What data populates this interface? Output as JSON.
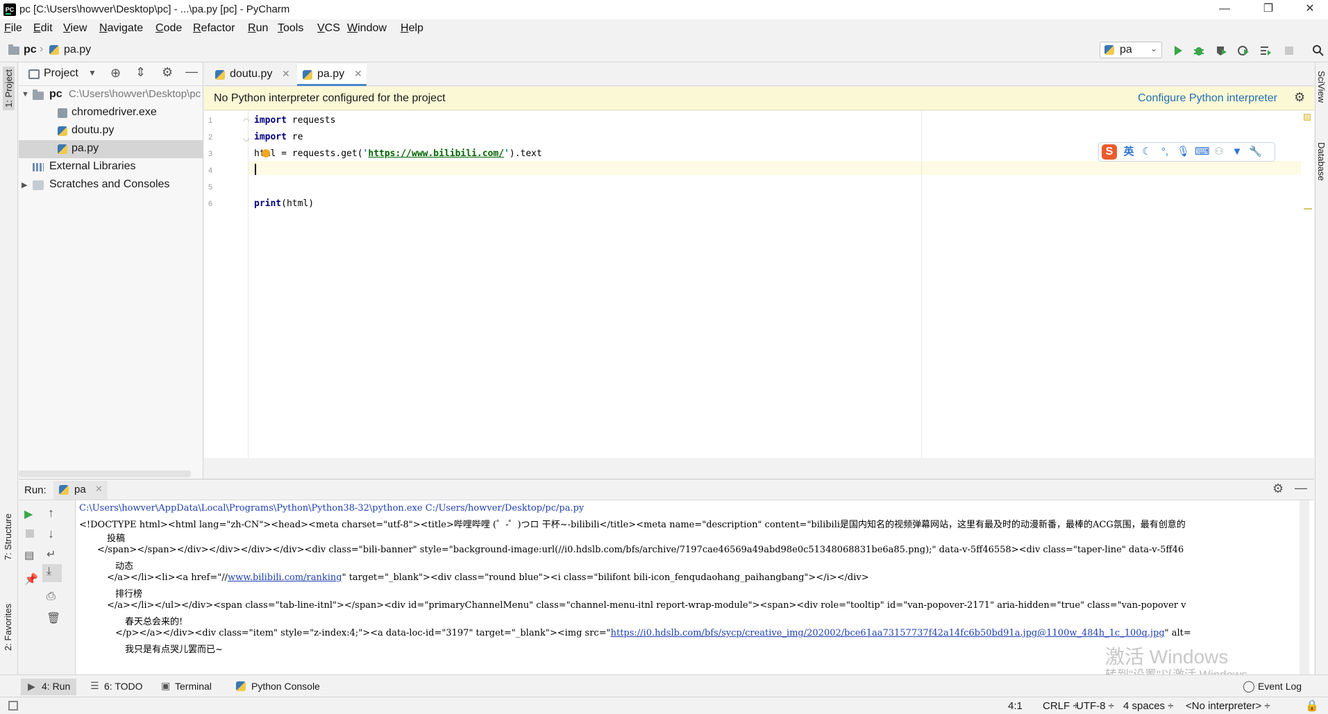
{
  "window": {
    "title": "pc [C:\\Users\\howver\\Desktop\\pc] - ...\\pa.py [pc] - PyCharm",
    "logo_text": "PC",
    "minimize": "—",
    "restore": "❐",
    "close": "✕"
  },
  "menu": [
    "File",
    "Edit",
    "View",
    "Navigate",
    "Code",
    "Refactor",
    "Run",
    "Tools",
    "VCS",
    "Window",
    "Help"
  ],
  "breadcrumb": {
    "project": "pc",
    "file": "pa.py"
  },
  "run_config": {
    "selected": "pa"
  },
  "left_stripe": {
    "project": "1: Project",
    "structure": "7: Structure",
    "favorites": "2: Favorites"
  },
  "right_stripe": {
    "sciview": "SciView",
    "database": "Database"
  },
  "project_panel": {
    "title": "Project",
    "root_label": "pc",
    "root_path": "C:\\Users\\howver\\Desktop\\pc",
    "files": [
      "chromedriver.exe",
      "doutu.py",
      "pa.py"
    ],
    "external": "External Libraries",
    "scratches": "Scratches and Consoles"
  },
  "editor": {
    "tabs": [
      {
        "label": "doutu.py",
        "active": false
      },
      {
        "label": "pa.py",
        "active": true
      }
    ],
    "notification": "No Python interpreter configured for the project",
    "notification_action": "Configure Python interpreter",
    "line_numbers": [
      "1",
      "2",
      "3",
      "4",
      "5",
      "6"
    ],
    "code": {
      "l1_kw": "import",
      "l1_rest": " requests",
      "l2_kw": "import",
      "l2_rest": " re",
      "l3_a": "html = requests.get(",
      "l3_q1": "'",
      "l3_url": "https://www.bilibili.com/",
      "l3_q2": "'",
      "l3_b": ").text",
      "l6_fn": "print",
      "l6_rest": "(html)"
    }
  },
  "ime": {
    "brand": "S",
    "mode": "英",
    "icons": [
      "moon-icon",
      "comma-icon",
      "mic-icon",
      "keyboard-icon",
      "user-icon",
      "shirt-icon",
      "wrench-icon"
    ]
  },
  "run_panel": {
    "label": "Run:",
    "tab": "pa",
    "console": {
      "l1": "C:\\Users\\howver\\AppData\\Local\\Programs\\Python\\Python38-32\\python.exe C:/Users/howver/Desktop/pc/pa.py",
      "l2": "<!DOCTYPE html><html lang=\"zh-CN\"><head><meta charset=\"utf-8\"><title>哔哩哔哩 (゜-゜)つロ 干杯~-bilibili</title><meta name=\"description\" content=\"bilibili是国内知名的视频弹幕网站，这里有最及时的动漫新番，最棒的ACG氛围，最有创意的",
      "l3": "投稿",
      "l4": "</span></span></div></div></div></div><div class=\"bili-banner\" style=\"background-image:url(//i0.hdslb.com/bfs/archive/7197cae46569a49abd98e0c51348068831be6a85.png);\" data-v-5ff46558><div class=\"taper-line\" data-v-5ff46",
      "l5": "动态",
      "l6_a": "</a></li><li><a href=\"//",
      "l6_link": "www.bilibili.com/ranking",
      "l6_b": "\" target=\"_blank\"><div class=\"round blue\"><i class=\"bilifont bili-icon_fenqudaohang_paihangbang\"></i></div>",
      "l7": "排行榜",
      "l8": "</a></li></ul></div><span class=\"tab-line-itnl\"></span><div id=\"primaryChannelMenu\" class=\"channel-menu-itnl report-wrap-module\"><span><div role=\"tooltip\" id=\"van-popover-2171\" aria-hidden=\"true\" class=\"van-popover v",
      "l9": "春天总会来的!",
      "l10_a": "</p></a></div><div class=\"item\" style=\"z-index:4;\"><a data-loc-id=\"3197\" target=\"_blank\"><img src=\"",
      "l10_link": "https://i0.hdslb.com/bfs/sycp/creative_img/202002/bce61aa73157737f42a14fc6b50bd91a.jpg@1100w_484h_1c_100q.jpg",
      "l10_b": "\" alt=",
      "l11": "我只是有点哭儿罢而已~"
    }
  },
  "watermark": {
    "line1": "激活 Windows",
    "line2": "转到\"设置\"以激活 Windows。"
  },
  "bottom_tabs": [
    "4: Run",
    "6: TODO",
    "Terminal",
    "Python Console"
  ],
  "event_log": "Event Log",
  "status": {
    "position": "4:1",
    "line_sep": "CRLF ÷",
    "encoding": "UTF-8 ÷",
    "indent": "4 spaces ÷",
    "interpreter": "<No interpreter> ÷"
  },
  "colors": {
    "accent": "#4a88c7",
    "run_green": "#3aa64a",
    "notify_bg": "#fbf8d6",
    "link": "#2470b3"
  }
}
